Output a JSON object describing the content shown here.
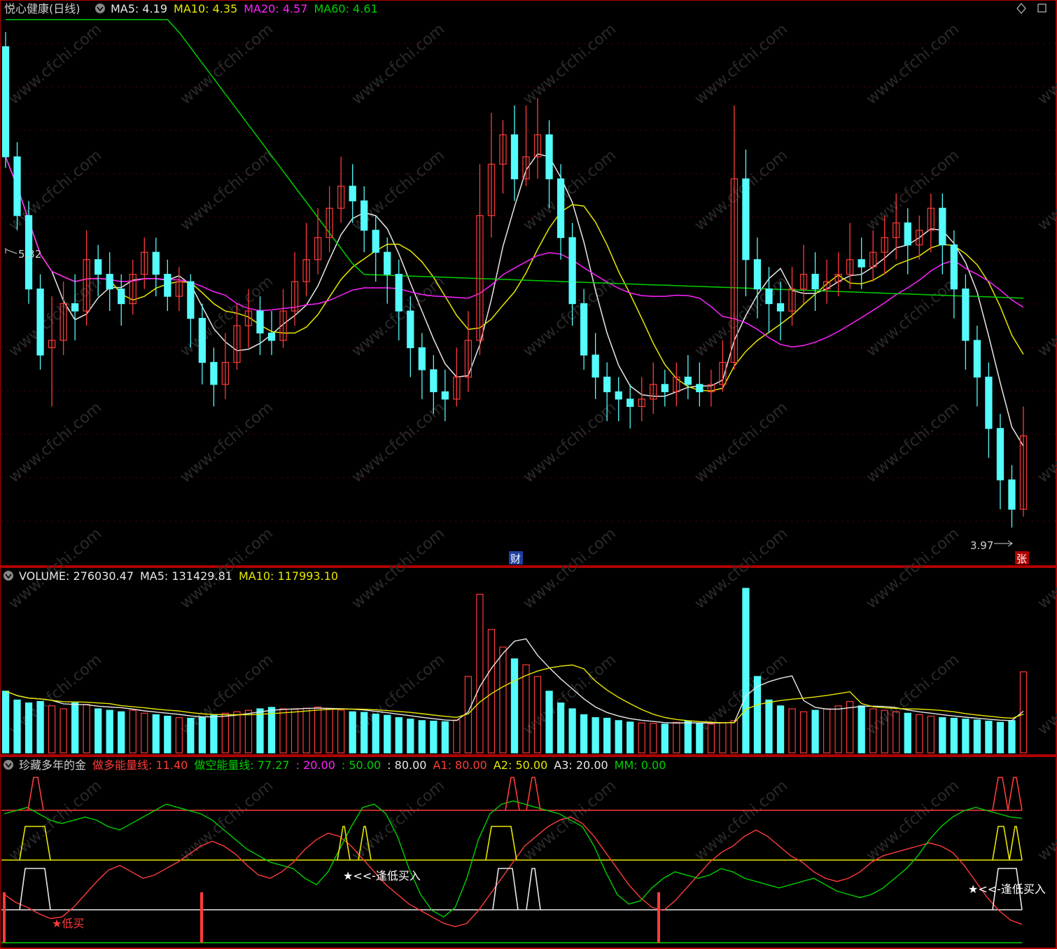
{
  "colors": {
    "up": "#ff3b3b",
    "down": "#54fcfc",
    "white": "#e8e8e8",
    "yellow": "#e7e700",
    "magenta": "#ff22ff",
    "green": "#00d000",
    "frame": "#b00000",
    "grid": "#5a0000",
    "label_gray": "#cfcfcf"
  },
  "price_panel": {
    "title": "悦心健康(日线)",
    "ma_legend": [
      {
        "label": "MA5: 4.19",
        "color": "#e8e8e8"
      },
      {
        "label": "MA10: 4.35",
        "color": "#e7e700"
      },
      {
        "label": "MA20: 4.57",
        "color": "#ff22ff"
      },
      {
        "label": "MA60: 4.61",
        "color": "#00d000"
      }
    ],
    "high_label": "5.32",
    "low_label": "3.97",
    "cai_badge": "财",
    "zhang_badge": "张",
    "corner_icons": [
      "diamond-icon",
      "square-icon"
    ]
  },
  "volume_panel": {
    "legend": [
      {
        "label": "VOLUME: 276030.47",
        "color": "#e8e8e8"
      },
      {
        "label": "MA5: 131429.81",
        "color": "#e8e8e8"
      },
      {
        "label": "MA10: 117993.10",
        "color": "#e7e700"
      }
    ]
  },
  "indicator_panel": {
    "legend": [
      {
        "label": "珍藏多年的金",
        "color": "#cfcfcf"
      },
      {
        "label": "做多能量线: 11.40",
        "color": "#ff3b3b"
      },
      {
        "label": "做空能量线: 77.27",
        "color": "#00d000"
      },
      {
        "label": ": 20.00",
        "color": "#ff22ff"
      },
      {
        "label": ": 50.00",
        "color": "#00d000"
      },
      {
        "label": ": 80.00",
        "color": "#e8e8e8"
      },
      {
        "label": "A1: 80.00",
        "color": "#ff3b3b"
      },
      {
        "label": "A2: 50.00",
        "color": "#e7e700"
      },
      {
        "label": "A3: 20.00",
        "color": "#e8e8e8"
      },
      {
        "label": "MM: 0.00",
        "color": "#00d000"
      }
    ],
    "annotations": {
      "low_buy": "★低买",
      "buy_low_1": "★<<-逢低买入",
      "buy_low_2": "★<<-逢低买入"
    }
  },
  "watermark": "www.cfchi.com",
  "chart_data": [
    {
      "type": "candlestick",
      "title": "悦心健康(日线)",
      "ylim": [
        3.9,
        5.35
      ],
      "series_ma": [
        "MA5",
        "MA10",
        "MA20",
        "MA60"
      ],
      "ma_values_latest": {
        "MA5": 4.19,
        "MA10": 4.35,
        "MA20": 4.57,
        "MA60": 4.61
      },
      "high": 5.32,
      "low": 3.97,
      "candles": [
        [
          5.28,
          4.98,
          5.32,
          4.95
        ],
        [
          4.98,
          4.82,
          5.02,
          4.78
        ],
        [
          4.82,
          4.62,
          4.86,
          4.58
        ],
        [
          4.62,
          4.44,
          4.66,
          4.4
        ],
        [
          4.46,
          4.48,
          4.6,
          4.3
        ],
        [
          4.48,
          4.58,
          4.64,
          4.44
        ],
        [
          4.58,
          4.56,
          4.66,
          4.48
        ],
        [
          4.56,
          4.7,
          4.78,
          4.52
        ],
        [
          4.7,
          4.66,
          4.74,
          4.6
        ],
        [
          4.66,
          4.62,
          4.72,
          4.56
        ],
        [
          4.62,
          4.58,
          4.66,
          4.52
        ],
        [
          4.58,
          4.66,
          4.7,
          4.55
        ],
        [
          4.66,
          4.72,
          4.76,
          4.62
        ],
        [
          4.72,
          4.66,
          4.76,
          4.6
        ],
        [
          4.66,
          4.6,
          4.7,
          4.56
        ],
        [
          4.6,
          4.64,
          4.68,
          4.56
        ],
        [
          4.64,
          4.54,
          4.66,
          4.46
        ],
        [
          4.54,
          4.42,
          4.58,
          4.36
        ],
        [
          4.42,
          4.36,
          4.46,
          4.3
        ],
        [
          4.36,
          4.42,
          4.5,
          4.32
        ],
        [
          4.42,
          4.52,
          4.58,
          4.4
        ],
        [
          4.52,
          4.56,
          4.62,
          4.46
        ],
        [
          4.56,
          4.5,
          4.6,
          4.44
        ],
        [
          4.5,
          4.48,
          4.56,
          4.44
        ],
        [
          4.48,
          4.56,
          4.62,
          4.46
        ],
        [
          4.56,
          4.64,
          4.72,
          4.52
        ],
        [
          4.64,
          4.7,
          4.8,
          4.6
        ],
        [
          4.7,
          4.76,
          4.84,
          4.66
        ],
        [
          4.76,
          4.84,
          4.9,
          4.72
        ],
        [
          4.84,
          4.9,
          4.98,
          4.8
        ],
        [
          4.9,
          4.86,
          4.96,
          4.8
        ],
        [
          4.86,
          4.78,
          4.9,
          4.72
        ],
        [
          4.78,
          4.72,
          4.82,
          4.64
        ],
        [
          4.72,
          4.66,
          4.76,
          4.58
        ],
        [
          4.66,
          4.56,
          4.7,
          4.48
        ],
        [
          4.56,
          4.46,
          4.6,
          4.38
        ],
        [
          4.46,
          4.4,
          4.5,
          4.32
        ],
        [
          4.4,
          4.34,
          4.44,
          4.28
        ],
        [
          4.34,
          4.32,
          4.4,
          4.26
        ],
        [
          4.32,
          4.38,
          4.46,
          4.3
        ],
        [
          4.38,
          4.48,
          4.56,
          4.34
        ],
        [
          4.48,
          4.82,
          4.96,
          4.44
        ],
        [
          4.82,
          4.96,
          5.1,
          4.76
        ],
        [
          4.96,
          5.04,
          5.08,
          4.88
        ],
        [
          5.04,
          4.92,
          5.12,
          4.86
        ],
        [
          4.92,
          4.98,
          5.12,
          4.9
        ],
        [
          4.98,
          5.04,
          5.14,
          4.92
        ],
        [
          5.04,
          4.92,
          5.08,
          4.84
        ],
        [
          4.92,
          4.76,
          4.96,
          4.7
        ],
        [
          4.76,
          4.58,
          4.8,
          4.52
        ],
        [
          4.58,
          4.44,
          4.62,
          4.4
        ],
        [
          4.44,
          4.38,
          4.5,
          4.32
        ],
        [
          4.38,
          4.34,
          4.42,
          4.26
        ],
        [
          4.34,
          4.32,
          4.38,
          4.26
        ],
        [
          4.32,
          4.3,
          4.36,
          4.24
        ],
        [
          4.3,
          4.32,
          4.38,
          4.26
        ],
        [
          4.32,
          4.36,
          4.42,
          4.28
        ],
        [
          4.36,
          4.34,
          4.4,
          4.3
        ],
        [
          4.34,
          4.38,
          4.42,
          4.3
        ],
        [
          4.38,
          4.36,
          4.44,
          4.32
        ],
        [
          4.36,
          4.34,
          4.42,
          4.3
        ],
        [
          4.34,
          4.36,
          4.4,
          4.3
        ],
        [
          4.36,
          4.42,
          4.48,
          4.34
        ],
        [
          4.42,
          4.92,
          5.12,
          4.4
        ],
        [
          4.92,
          4.7,
          5.0,
          4.6
        ],
        [
          4.7,
          4.62,
          4.76,
          4.54
        ],
        [
          4.62,
          4.58,
          4.68,
          4.5
        ],
        [
          4.58,
          4.56,
          4.64,
          4.48
        ],
        [
          4.56,
          4.62,
          4.68,
          4.52
        ],
        [
          4.62,
          4.66,
          4.74,
          4.58
        ],
        [
          4.66,
          4.62,
          4.72,
          4.56
        ],
        [
          4.62,
          4.64,
          4.7,
          4.58
        ],
        [
          4.64,
          4.66,
          4.72,
          4.6
        ],
        [
          4.66,
          4.7,
          4.8,
          4.62
        ],
        [
          4.7,
          4.68,
          4.76,
          4.62
        ],
        [
          4.68,
          4.72,
          4.78,
          4.64
        ],
        [
          4.72,
          4.76,
          4.82,
          4.66
        ],
        [
          4.76,
          4.8,
          4.88,
          4.7
        ],
        [
          4.8,
          4.74,
          4.84,
          4.66
        ],
        [
          4.74,
          4.78,
          4.82,
          4.7
        ],
        [
          4.78,
          4.84,
          4.88,
          4.72
        ],
        [
          4.84,
          4.74,
          4.88,
          4.66
        ],
        [
          4.74,
          4.62,
          4.78,
          4.54
        ],
        [
          4.62,
          4.48,
          4.66,
          4.4
        ],
        [
          4.48,
          4.38,
          4.52,
          4.3
        ],
        [
          4.38,
          4.24,
          4.42,
          4.16
        ],
        [
          4.24,
          4.1,
          4.28,
          4.02
        ],
        [
          4.1,
          4.02,
          4.14,
          3.97
        ],
        [
          4.02,
          4.22,
          4.3,
          4.0
        ]
      ]
    },
    {
      "type": "bar",
      "title": "VOLUME",
      "latest": 276030.47,
      "ma5_latest": 131429.81,
      "ma10_latest": 117993.1,
      "values": [
        210,
        180,
        170,
        175,
        160,
        150,
        170,
        165,
        150,
        145,
        140,
        145,
        135,
        130,
        125,
        120,
        118,
        122,
        128,
        135,
        140,
        145,
        150,
        155,
        150,
        148,
        152,
        156,
        150,
        146,
        140,
        138,
        132,
        128,
        120,
        115,
        110,
        108,
        106,
        112,
        260,
        540,
        420,
        360,
        320,
        300,
        260,
        210,
        170,
        150,
        130,
        120,
        118,
        110,
        105,
        102,
        100,
        98,
        104,
        108,
        100,
        98,
        102,
        110,
        560,
        260,
        180,
        160,
        150,
        140,
        145,
        150,
        160,
        175,
        160,
        150,
        145,
        140,
        135,
        130,
        125,
        120,
        118,
        115,
        112,
        108,
        104,
        110,
        276
      ],
      "ylim": [
        0,
        560
      ]
    },
    {
      "type": "line",
      "title": "珍藏多年的金",
      "series": [
        {
          "name": "做多能量线",
          "latest": 11.4
        },
        {
          "name": "做空能量线",
          "latest": 77.27
        },
        {
          "name": "A1",
          "latest": 80.0
        },
        {
          "name": "A2",
          "latest": 50.0
        },
        {
          "name": "A3",
          "latest": 20.0
        },
        {
          "name": "MM",
          "latest": 0.0
        }
      ],
      "reference_lines": [
        20.0,
        50.0,
        80.0
      ],
      "red_energy": [
        30,
        25,
        22,
        18,
        15,
        16,
        22,
        30,
        38,
        45,
        48,
        44,
        40,
        42,
        46,
        50,
        55,
        60,
        63,
        60,
        55,
        48,
        42,
        40,
        44,
        50,
        58,
        64,
        68,
        66,
        60,
        52,
        44,
        36,
        30,
        24,
        20,
        16,
        12,
        10,
        12,
        20,
        30,
        40,
        50,
        60,
        66,
        72,
        76,
        78,
        74,
        66,
        56,
        46,
        36,
        28,
        22,
        20,
        26,
        34,
        42,
        50,
        56,
        60,
        66,
        70,
        66,
        60,
        54,
        50,
        44,
        40,
        38,
        40,
        44,
        50,
        54,
        56,
        58,
        60,
        62,
        60,
        56,
        48,
        38,
        28,
        20,
        14,
        11.4
      ],
      "green_energy": [
        80,
        82,
        84,
        80,
        76,
        74,
        76,
        78,
        76,
        72,
        70,
        74,
        78,
        82,
        86,
        84,
        82,
        80,
        76,
        70,
        64,
        58,
        54,
        50,
        48,
        46,
        40,
        36,
        44,
        58,
        72,
        84,
        86,
        80,
        66,
        46,
        30,
        20,
        16,
        22,
        40,
        64,
        80,
        86,
        88,
        86,
        84,
        82,
        80,
        76,
        72,
        60,
        44,
        30,
        24,
        26,
        34,
        40,
        44,
        42,
        40,
        42,
        46,
        44,
        40,
        38,
        36,
        34,
        36,
        38,
        40,
        36,
        32,
        30,
        28,
        30,
        34,
        40,
        46,
        54,
        64,
        72,
        78,
        82,
        84,
        82,
        80,
        78,
        77.27
      ]
    }
  ]
}
